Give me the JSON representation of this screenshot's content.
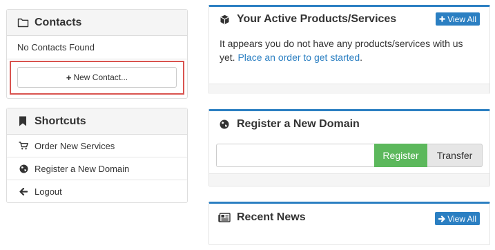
{
  "contacts": {
    "title": "Contacts",
    "icon": "folder-icon",
    "empty_text": "No Contacts Found",
    "new_button_label": "New Contact..."
  },
  "shortcuts": {
    "title": "Shortcuts",
    "icon": "bookmark-icon",
    "items": [
      {
        "label": "Order New Services",
        "icon": "cart-icon"
      },
      {
        "label": "Register a New Domain",
        "icon": "globe-icon"
      },
      {
        "label": "Logout",
        "icon": "arrow-left-icon"
      }
    ]
  },
  "products": {
    "title": "Your Active Products/Services",
    "icon": "cube-icon",
    "view_all_label": "View All",
    "body_text": "It appears you do not have any products/services with us yet.",
    "link_text": "Place an order to get started",
    "trailing": "."
  },
  "domain": {
    "title": "Register a New Domain",
    "icon": "globe-icon",
    "input_value": "",
    "register_label": "Register",
    "transfer_label": "Transfer"
  },
  "news": {
    "title": "Recent News",
    "icon": "newspaper-icon",
    "view_all_label": "View All"
  },
  "colors": {
    "accent": "#2b7fc2",
    "success": "#5cb85c",
    "highlight_border": "#d9534f",
    "panel_header_bg": "#f5f5f5"
  }
}
